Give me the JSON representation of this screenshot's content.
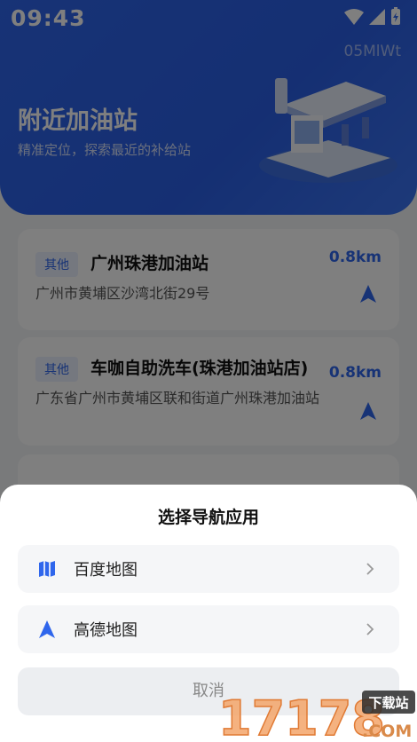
{
  "status_bar": {
    "time": "09:43",
    "icons": [
      "wifi-icon",
      "signal-icon",
      "battery-icon"
    ]
  },
  "header": {
    "device_id": "05MlWt",
    "title": "附近加油站",
    "subtitle": "精准定位，探索最近的补给站",
    "illustration": "gas-station-illustration"
  },
  "stations": [
    {
      "tag": "其他",
      "name": "广州珠港加油站",
      "address": "广州市黄埔区沙湾北街29号",
      "distance": "0.8km"
    },
    {
      "tag": "其他",
      "name": "车咖自助洗车(珠港加油站店)",
      "address": "广东省广州市黄埔区联和街道广州珠港加油站",
      "distance": "0.8km"
    }
  ],
  "sheet": {
    "title": "选择导航应用",
    "options": [
      {
        "label": "百度地图",
        "icon": "map-icon"
      },
      {
        "label": "高德地图",
        "icon": "navigation-arrow-icon"
      }
    ],
    "cancel_label": "取消"
  },
  "watermark": {
    "text": "17178",
    "badge": "下载站",
    "suffix": ".COM"
  },
  "colors": {
    "brand_blue": "#2f66ec",
    "overlay": "rgba(0,0,0,0.5)"
  }
}
